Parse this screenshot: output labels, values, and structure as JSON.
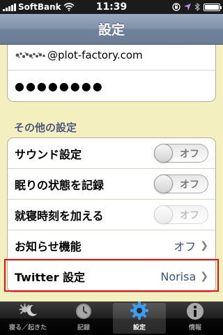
{
  "status_bar": {
    "carrier": "SoftBank",
    "time": "11:39"
  },
  "nav": {
    "title": "設定"
  },
  "account": {
    "email": "@plot-factory.com",
    "password_mask": "●●●●●●●●"
  },
  "other_settings": {
    "header": "その他の設定",
    "rows": [
      {
        "label": "サウンド設定",
        "toggle_text": "オフ"
      },
      {
        "label": "眠りの状態を記録",
        "toggle_text": "オフ"
      },
      {
        "label": "就寝時刻を加える",
        "toggle_text": "オフ"
      },
      {
        "label": "お知らせ機能",
        "detail": "オフ"
      },
      {
        "label": "Twitter 設定",
        "detail": "Norisa"
      }
    ]
  },
  "tabs": [
    {
      "label": "寝る／起きた",
      "icon": "sun-moon-icon"
    },
    {
      "label": "記録",
      "icon": "clock-icon"
    },
    {
      "label": "設定",
      "icon": "gear-icon",
      "active": true
    },
    {
      "label": "情報",
      "icon": "info-icon"
    }
  ],
  "colors": {
    "background": "#f3efbf",
    "nav": "#7f91a8",
    "detail_text": "#385487",
    "highlight": "#e01212"
  }
}
